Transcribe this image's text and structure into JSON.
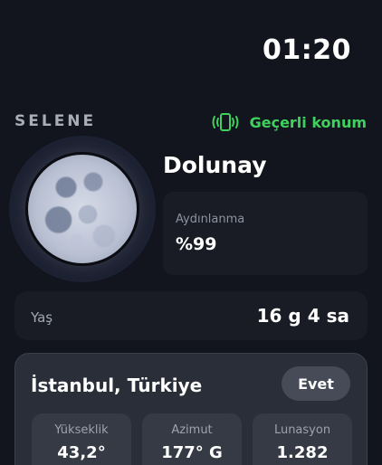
{
  "status_bar": {
    "time": "01:20"
  },
  "header": {
    "brand": "SELENE",
    "location_status": "Geçerli konum",
    "location_status_icon": "phone-vibrate-icon",
    "accent_color": "#3fd15e"
  },
  "moon": {
    "phase_name": "Dolunay",
    "illumination_label": "Aydınlanma",
    "illumination_value": "%99"
  },
  "age": {
    "label": "Yaş",
    "value": "16 g 4 sa"
  },
  "location": {
    "name": "İstanbul, Türkiye",
    "button_label": "Evet",
    "stats": [
      {
        "label": "Yükseklik",
        "value": "43,2°"
      },
      {
        "label": "Azimut",
        "value": "177° G"
      },
      {
        "label": "Lunasyon",
        "value": "1.282"
      }
    ]
  }
}
